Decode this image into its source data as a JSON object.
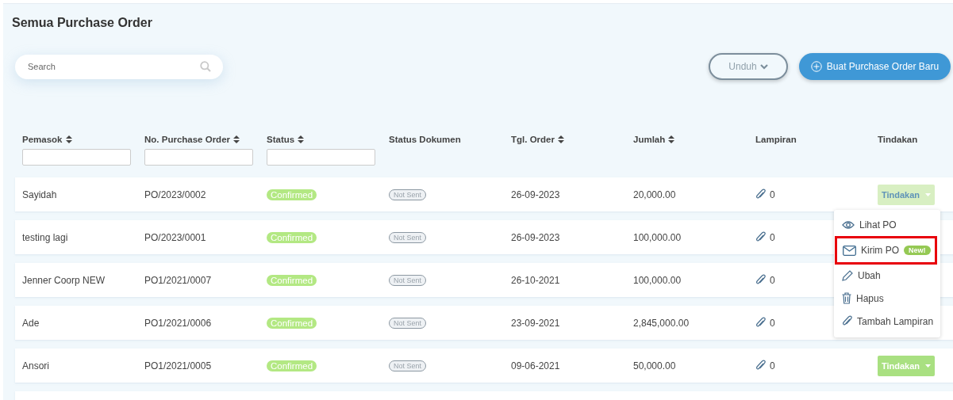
{
  "title": "Semua Purchase Order",
  "search": {
    "placeholder": "Search"
  },
  "buttons": [
    {
      "kind": "outline",
      "label": "Unduh"
    },
    {
      "kind": "primary",
      "label": "Buat Purchase Order Baru"
    }
  ],
  "table": {
    "columns": [
      {
        "label": "Pemasok",
        "sortable": true,
        "filter": true
      },
      {
        "label": "No. Purchase Order",
        "sortable": true,
        "filter": true
      },
      {
        "label": "Status",
        "sortable": true,
        "filter": true
      },
      {
        "label": "Status Dokumen",
        "sortable": false,
        "filter": false
      },
      {
        "label": "Tgl. Order",
        "sortable": true,
        "filter": false
      },
      {
        "label": "Jumlah",
        "sortable": true,
        "filter": false
      },
      {
        "label": "Lampiran",
        "sortable": false,
        "filter": false
      },
      {
        "label": "Tindakan",
        "sortable": false,
        "filter": false
      }
    ],
    "rows": [
      {
        "supplier": "Sayidah",
        "po_number": "PO/2023/0002",
        "status": "Confirmed",
        "doc_status": "Not Sent",
        "date": "26-09-2023",
        "amount": "20,000.00",
        "attachments": "0",
        "action": {
          "label": "Tindakan",
          "open": true
        }
      },
      {
        "supplier": "testing lagi",
        "po_number": "PO/2023/0001",
        "status": "Confirmed",
        "doc_status": "Not Sent",
        "date": "26-09-2023",
        "amount": "100,000.00",
        "attachments": "0"
      },
      {
        "supplier": "Jenner Coorp NEW",
        "po_number": "PO1/2021/0007",
        "status": "Confirmed",
        "doc_status": "Not Sent",
        "date": "26-10-2021",
        "amount": "100,000.00",
        "attachments": "0"
      },
      {
        "supplier": "Ade",
        "po_number": "PO1/2021/0006",
        "status": "Confirmed",
        "doc_status": "Not Sent",
        "date": "23-09-2021",
        "amount": "2,845,000.00",
        "attachments": "0"
      },
      {
        "supplier": "Ansori",
        "po_number": "PO1/2021/0005",
        "status": "Confirmed",
        "doc_status": "Not Sent",
        "date": "09-06-2021",
        "amount": "50,000.00",
        "attachments": "0",
        "action": {
          "label": "Tindakan",
          "open": false
        }
      }
    ]
  },
  "action_menu": {
    "items": [
      {
        "kind": "eye",
        "label": "Lihat PO",
        "highlighted": false
      },
      {
        "kind": "mail",
        "label": "Kirim PO",
        "badge": "New!",
        "highlighted": true
      },
      {
        "kind": "pencil",
        "label": "Ubah",
        "highlighted": false
      },
      {
        "kind": "trash",
        "label": "Hapus",
        "highlighted": false
      },
      {
        "kind": "clip",
        "label": "Tambah Lampiran",
        "highlighted": false
      }
    ]
  }
}
